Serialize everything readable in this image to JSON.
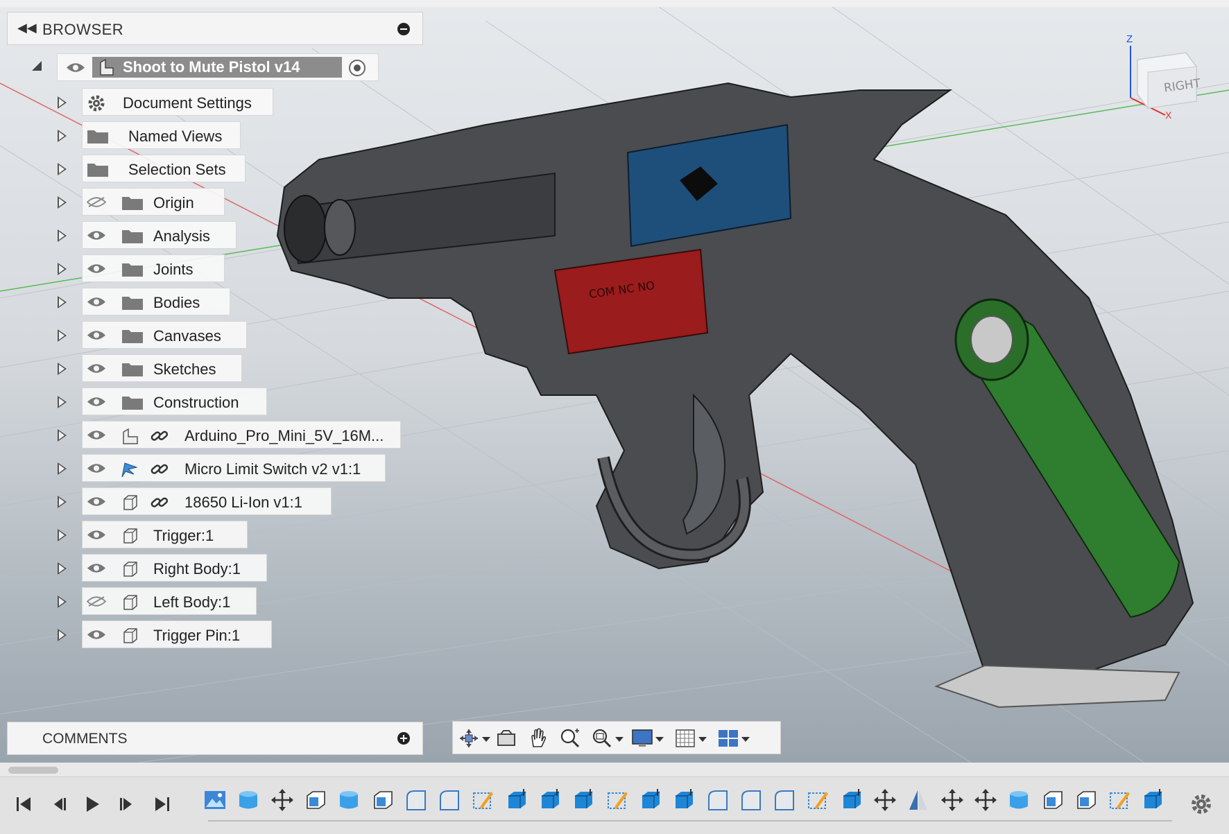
{
  "browser": {
    "header_title": "BROWSER",
    "root": {
      "label": "Shoot to Mute Pistol v14"
    },
    "items": [
      {
        "label": "Document Settings",
        "icon": "gear-icon",
        "visible": null
      },
      {
        "label": "Named Views",
        "icon": "folder-icon",
        "visible": null
      },
      {
        "label": "Selection Sets",
        "icon": "folder-icon",
        "visible": null
      },
      {
        "label": "Origin",
        "icon": "folder-icon",
        "visible": false
      },
      {
        "label": "Analysis",
        "icon": "folder-icon",
        "visible": true
      },
      {
        "label": "Joints",
        "icon": "folder-icon",
        "visible": true
      },
      {
        "label": "Bodies",
        "icon": "folder-icon",
        "visible": true
      },
      {
        "label": "Canvases",
        "icon": "folder-icon",
        "visible": true
      },
      {
        "label": "Sketches",
        "icon": "folder-icon",
        "visible": true
      },
      {
        "label": "Construction",
        "icon": "folder-icon",
        "visible": true
      },
      {
        "label": "Arduino_Pro_Mini_5V_16M...",
        "icon": "component-icon",
        "linked": true,
        "visible": true
      },
      {
        "label": "Micro Limit Switch v2 v1:1",
        "icon": "flag-component-icon",
        "linked": true,
        "visible": true
      },
      {
        "label": "18650 Li-Ion v1:1",
        "icon": "body-icon",
        "linked": true,
        "visible": true
      },
      {
        "label": "Trigger:1",
        "icon": "body-icon",
        "visible": true
      },
      {
        "label": "Right Body:1",
        "icon": "body-icon",
        "visible": true
      },
      {
        "label": "Left Body:1",
        "icon": "body-icon",
        "visible": false
      },
      {
        "label": "Trigger Pin:1",
        "icon": "body-icon",
        "visible": true
      }
    ]
  },
  "comments": {
    "title": "COMMENTS"
  },
  "viewcube": {
    "face_label": "RIGHT",
    "axis_z": "Z",
    "axis_x": "X"
  },
  "navbar": {
    "tools": [
      "orbit-icon",
      "look-at-icon",
      "pan-icon",
      "zoom-icon",
      "zoom-window-icon",
      "display-settings-icon",
      "grid-settings-icon",
      "viewports-icon"
    ]
  },
  "timeline": {
    "playback": [
      "go-to-start-icon",
      "step-back-icon",
      "play-icon",
      "step-forward-icon",
      "go-to-end-icon"
    ],
    "features": [
      "canvas",
      "extrude",
      "move",
      "shell",
      "extrude",
      "offset",
      "fillet",
      "chamfer",
      "sketch",
      "press-pull",
      "press-pull",
      "press-pull",
      "sketch",
      "press-pull",
      "press-pull",
      "fillet",
      "chamfer",
      "fillet",
      "sketch",
      "press-pull",
      "move",
      "mirror",
      "move",
      "move",
      "extrude",
      "shell",
      "shell",
      "sketch",
      "press-pull"
    ]
  },
  "colors": {
    "accent_selection": "#8c8c8c",
    "board_blue": "#1e4f7a",
    "switch_red": "#9a1c1c",
    "battery_green": "#2f7d2f",
    "body_gray": "#4a4c4f"
  }
}
